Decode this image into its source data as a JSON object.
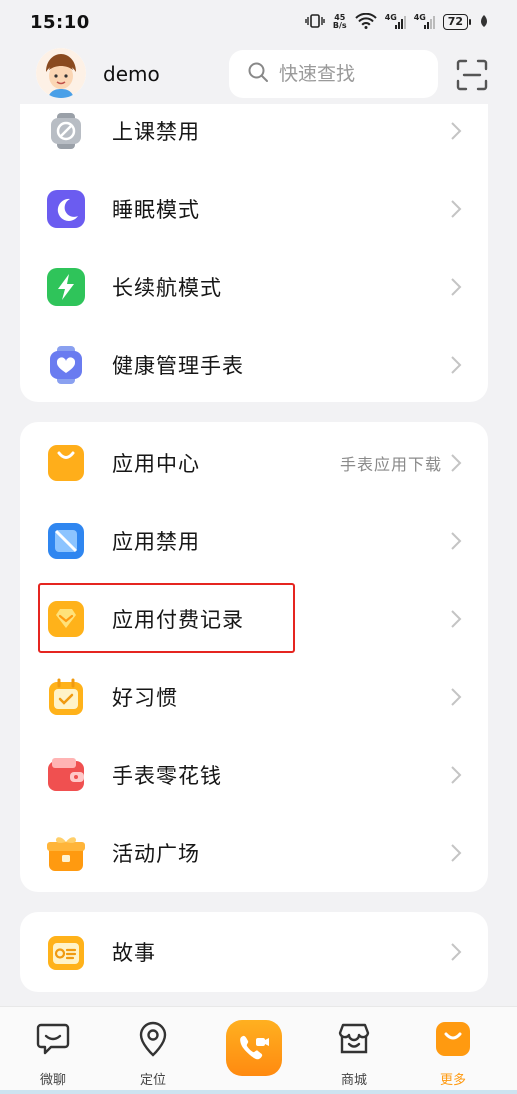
{
  "status": {
    "time": "15:10",
    "net_top": "45",
    "net_bottom": "B/s",
    "sig1": "4G",
    "sig2": "4G",
    "battery": "72"
  },
  "header": {
    "username": "demo",
    "search_placeholder": "快速查找"
  },
  "groups": [
    {
      "items": [
        {
          "label": "上课禁用",
          "icon": "class-ban-icon"
        },
        {
          "label": "睡眠模式",
          "icon": "moon-icon"
        },
        {
          "label": "长续航模式",
          "icon": "lightning-icon"
        },
        {
          "label": "健康管理手表",
          "icon": "health-watch-icon"
        }
      ]
    },
    {
      "items": [
        {
          "label": "应用中心",
          "hint": "手表应用下载",
          "icon": "app-center-icon"
        },
        {
          "label": "应用禁用",
          "icon": "app-ban-icon"
        },
        {
          "label": "应用付费记录",
          "icon": "payment-record-icon"
        },
        {
          "label": "好习惯",
          "icon": "calendar-check-icon"
        },
        {
          "label": "手表零花钱",
          "icon": "wallet-icon"
        },
        {
          "label": "活动广场",
          "icon": "gift-icon"
        }
      ]
    },
    {
      "items": [
        {
          "label": "故事",
          "icon": "radio-icon"
        }
      ]
    }
  ],
  "tabs": [
    {
      "label": "微聊",
      "icon": "chat-icon"
    },
    {
      "label": "定位",
      "icon": "location-icon"
    },
    {
      "label": "",
      "icon": "video-call-icon"
    },
    {
      "label": "商城",
      "icon": "store-icon"
    },
    {
      "label": "更多",
      "icon": "more-icon"
    }
  ],
  "colors": {
    "accent": "#ff9a10",
    "highlight": "#e52520",
    "purple": "#6b5cf0",
    "green": "#2fc45a",
    "blue": "#2f86f0",
    "red": "#f05050"
  }
}
